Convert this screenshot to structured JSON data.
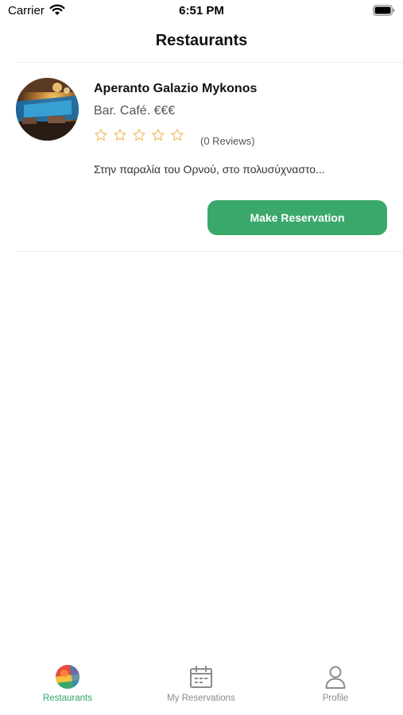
{
  "status_bar": {
    "carrier": "Carrier",
    "time": "6:51 PM",
    "icons": [
      "wifi-icon",
      "battery-icon"
    ]
  },
  "nav": {
    "title": "Restaurants"
  },
  "restaurants": [
    {
      "name": "Aperanto Galazio Mykonos",
      "type": "Bar. Café. €€€",
      "rating_stars_filled": 0,
      "rating_stars_total": 5,
      "reviews": "(0 Reviews)",
      "description": "Στην παραλία του Ορνού, στο πολυσύχναστο...",
      "button_label": "Make Reservation",
      "image_icon": "restaurant-photo"
    }
  ],
  "tab_bar": {
    "tabs": [
      {
        "label": "Restaurants",
        "icon": "restaurants-logo-icon",
        "active": true
      },
      {
        "label": "My Reservations",
        "icon": "calendar-icon",
        "active": false
      },
      {
        "label": "Profile",
        "icon": "person-icon",
        "active": false
      }
    ]
  },
  "colors": {
    "accent": "#3ba86b",
    "active_tab": "#2fa562",
    "inactive_tab": "#8a8a8f",
    "star_outline": "#f2b55c"
  }
}
